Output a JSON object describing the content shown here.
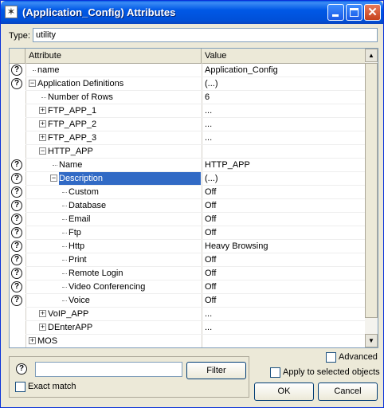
{
  "window": {
    "title": "(Application_Config) Attributes",
    "icon": "star-icon"
  },
  "type_field": {
    "label": "Type:",
    "value": "utility"
  },
  "grid": {
    "columns": [
      "Attribute",
      "Value"
    ],
    "rows": [
      {
        "label": "name",
        "value": "Application_Config"
      },
      {
        "label": "Application Definitions",
        "value": "(...)"
      },
      {
        "label": "Number of Rows",
        "value": "6"
      },
      {
        "label": "FTP_APP_1",
        "value": "..."
      },
      {
        "label": "FTP_APP_2",
        "value": "..."
      },
      {
        "label": "FTP_APP_3",
        "value": "..."
      },
      {
        "label": "HTTP_APP",
        "value": ""
      },
      {
        "label": "Name",
        "value": "HTTP_APP"
      },
      {
        "label": "Description",
        "value": "(...)"
      },
      {
        "label": "Custom",
        "value": "Off"
      },
      {
        "label": "Database",
        "value": "Off"
      },
      {
        "label": "Email",
        "value": "Off"
      },
      {
        "label": "Ftp",
        "value": "Off"
      },
      {
        "label": "Http",
        "value": "Heavy Browsing"
      },
      {
        "label": "Print",
        "value": "Off"
      },
      {
        "label": "Remote Login",
        "value": "Off"
      },
      {
        "label": "Video Conferencing",
        "value": "Off"
      },
      {
        "label": "Voice",
        "value": "Off"
      },
      {
        "label": "VoIP_APP",
        "value": "..."
      },
      {
        "label": "DEnterAPP",
        "value": "..."
      },
      {
        "label": "MOS",
        "value": ""
      }
    ],
    "selected_row": "Description"
  },
  "filter": {
    "value": "",
    "button_label": "Filter"
  },
  "options": {
    "exact_match": "Exact match",
    "advanced": "Advanced",
    "apply_selected": "Apply to selected objects"
  },
  "buttons": {
    "ok": "OK",
    "cancel": "Cancel"
  },
  "help_glyph": "?",
  "colors": {
    "titlebar": "#0058e6",
    "selection": "#316ac5"
  }
}
